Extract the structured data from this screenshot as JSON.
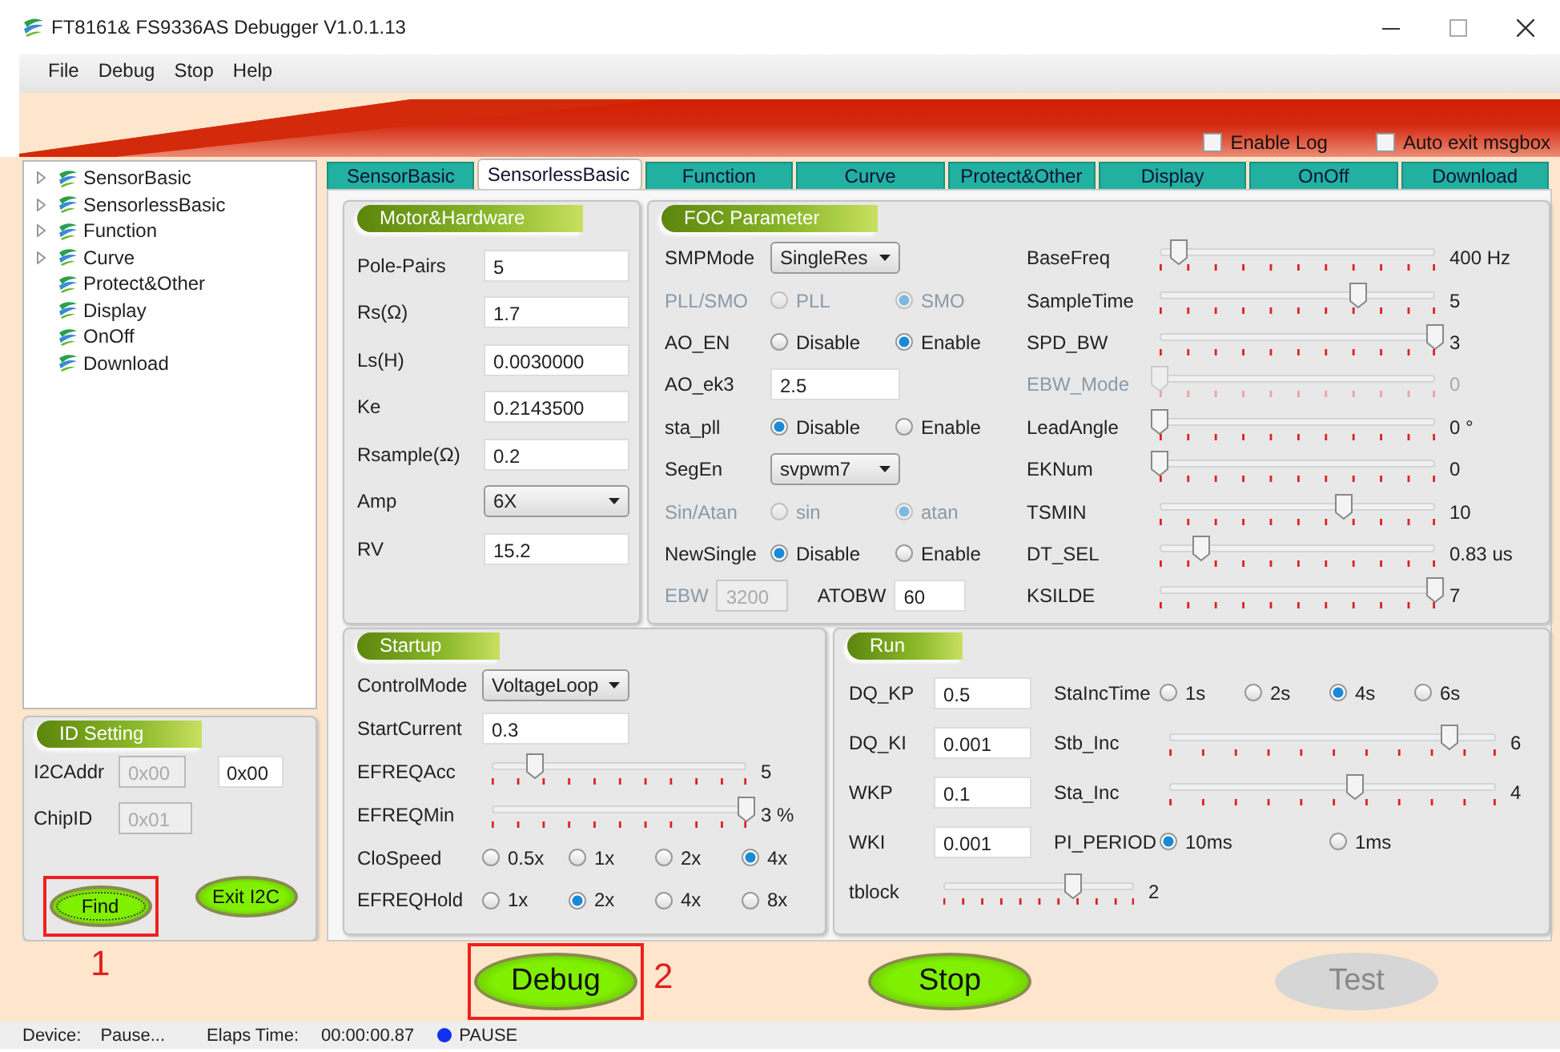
{
  "window": {
    "title": "FT8161& FS9336AS Debugger V1.0.1.13"
  },
  "menu": [
    "File",
    "Debug",
    "Stop",
    "Help"
  ],
  "options": [
    {
      "label": "Enable Log",
      "checked": false
    },
    {
      "label": "Auto exit msgbox",
      "checked": false
    }
  ],
  "tree": [
    {
      "label": "SensorBasic",
      "has_children": true
    },
    {
      "label": "SensorlessBasic",
      "has_children": true
    },
    {
      "label": "Function",
      "has_children": true
    },
    {
      "label": "Curve",
      "has_children": true
    },
    {
      "label": "Protect&Other",
      "has_children": false
    },
    {
      "label": "Display",
      "has_children": false
    },
    {
      "label": "OnOff",
      "has_children": false
    },
    {
      "label": "Download",
      "has_children": false
    }
  ],
  "tabs": [
    {
      "label": "SensorBasic",
      "selected": false
    },
    {
      "label": "SensorlessBasic",
      "selected": true
    },
    {
      "label": "Function",
      "selected": false
    },
    {
      "label": "Curve",
      "selected": false
    },
    {
      "label": "Protect&Other",
      "selected": false
    },
    {
      "label": "Display",
      "selected": false
    },
    {
      "label": "OnOff",
      "selected": false
    },
    {
      "label": "Download",
      "selected": false
    }
  ],
  "panels": [
    {
      "title": "Motor&Hardware",
      "columns": [
        [
          {
            "label": "Pole-Pairs",
            "kind": "input",
            "value": "5",
            "disabled": false
          },
          {
            "label": "Rs(Ω)",
            "kind": "input",
            "value": "1.7",
            "disabled": false
          },
          {
            "label": "Ls(H)",
            "kind": "input",
            "value": "0.0030000",
            "disabled": false
          },
          {
            "label": "Ke",
            "kind": "input",
            "value": "0.2143500",
            "disabled": false
          },
          {
            "label": "Rsample(Ω)",
            "kind": "input",
            "value": "0.2",
            "disabled": false
          },
          {
            "label": "Amp",
            "kind": "select",
            "value": "6X",
            "disabled": false
          },
          {
            "label": "RV",
            "kind": "input",
            "value": "15.2",
            "disabled": false
          }
        ]
      ]
    },
    {
      "title": "FOC Parameter",
      "columns": [
        [
          {
            "label": "SMPMode",
            "kind": "select",
            "value": "SingleRes",
            "disabled": false
          },
          {
            "label": "PLL/SMO",
            "kind": "radio",
            "disabled": true,
            "options": [
              {
                "label": "PLL",
                "selected": false
              },
              {
                "label": "SMO",
                "selected": true
              }
            ]
          },
          {
            "label": "AO_EN",
            "kind": "radio",
            "disabled": false,
            "options": [
              {
                "label": "Disable",
                "selected": false
              },
              {
                "label": "Enable",
                "selected": true
              }
            ]
          },
          {
            "label": "AO_ek3",
            "kind": "input",
            "value": "2.5",
            "disabled": false
          },
          {
            "label": "sta_pll",
            "kind": "radio",
            "disabled": false,
            "options": [
              {
                "label": "Disable",
                "selected": true
              },
              {
                "label": "Enable",
                "selected": false
              }
            ]
          },
          {
            "label": "SegEn",
            "kind": "select",
            "value": "svpwm7",
            "disabled": false
          },
          {
            "label": "Sin/Atan",
            "kind": "radio",
            "disabled": true,
            "options": [
              {
                "label": "sin",
                "selected": false
              },
              {
                "label": "atan",
                "selected": true
              }
            ]
          },
          {
            "label": "NewSingle",
            "kind": "radio",
            "disabled": false,
            "options": [
              {
                "label": "Disable",
                "selected": true
              },
              {
                "label": "Enable",
                "selected": false
              }
            ]
          },
          {
            "kind": "inputs",
            "fields": [
              {
                "label": "EBW",
                "value": "3200",
                "disabled": true
              },
              {
                "label": "ATOBW",
                "value": "60",
                "disabled": false
              }
            ]
          }
        ],
        [
          {
            "label": "BaseFreq",
            "kind": "slider",
            "level": 0.07,
            "reading": "400 Hz",
            "disabled": false
          },
          {
            "label": "SampleTime",
            "kind": "slider",
            "level": 0.72,
            "reading": "5",
            "disabled": false
          },
          {
            "label": "SPD_BW",
            "kind": "slider",
            "level": 1,
            "reading": "3",
            "disabled": false
          },
          {
            "label": "EBW_Mode",
            "kind": "slider",
            "level": 0,
            "reading": "0",
            "disabled": true
          },
          {
            "label": "LeadAngle",
            "kind": "slider",
            "level": 0,
            "reading": "0 °",
            "disabled": false
          },
          {
            "label": "EKNum",
            "kind": "slider",
            "level": 0,
            "reading": "0",
            "disabled": false
          },
          {
            "label": "TSMIN",
            "kind": "slider",
            "level": 0.67,
            "reading": "10",
            "disabled": false
          },
          {
            "label": "DT_SEL",
            "kind": "slider",
            "level": 0.15,
            "reading": "0.83 us",
            "disabled": false
          },
          {
            "label": "KSILDE",
            "kind": "slider",
            "level": 1,
            "reading": "7",
            "disabled": false
          }
        ]
      ]
    },
    {
      "title": "Startup",
      "columns": [
        [
          {
            "label": "ControlMode",
            "kind": "select",
            "value": "VoltageLoop",
            "disabled": false
          },
          {
            "label": "StartCurrent",
            "kind": "input",
            "value": "0.3",
            "disabled": false
          },
          {
            "label": "EFREQAcc",
            "kind": "slider",
            "level": 0.17,
            "reading": "5",
            "disabled": false
          },
          {
            "label": "EFREQMin",
            "kind": "slider",
            "level": 1,
            "reading": "3 %",
            "disabled": false
          },
          {
            "label": "CloSpeed",
            "kind": "radio",
            "disabled": false,
            "options": [
              {
                "label": "0.5x",
                "selected": false
              },
              {
                "label": "1x",
                "selected": false
              },
              {
                "label": "2x",
                "selected": false
              },
              {
                "label": "4x",
                "selected": true
              }
            ]
          },
          {
            "label": "EFREQHold",
            "kind": "radio",
            "disabled": false,
            "options": [
              {
                "label": "1x",
                "selected": false
              },
              {
                "label": "2x",
                "selected": true
              },
              {
                "label": "4x",
                "selected": false
              },
              {
                "label": "8x",
                "selected": false
              }
            ]
          }
        ]
      ]
    },
    {
      "title": "Run",
      "columns": [
        [
          {
            "label": "DQ_KP",
            "kind": "input",
            "value": "0.5",
            "disabled": false
          },
          {
            "label": "DQ_KI",
            "kind": "input",
            "value": "0.001",
            "disabled": false
          },
          {
            "label": "WKP",
            "kind": "input",
            "value": "0.1",
            "disabled": false
          },
          {
            "label": "WKI",
            "kind": "input",
            "value": "0.001",
            "disabled": false
          }
        ],
        [
          {
            "label": "StaIncTime",
            "kind": "radio",
            "disabled": false,
            "options": [
              {
                "label": "1s",
                "selected": false
              },
              {
                "label": "2s",
                "selected": false
              },
              {
                "label": "4s",
                "selected": true
              },
              {
                "label": "6s",
                "selected": false
              }
            ]
          },
          {
            "label": "Stb_Inc",
            "kind": "slider",
            "level": 0.86,
            "reading": "6",
            "disabled": false
          },
          {
            "label": "Sta_Inc",
            "kind": "slider",
            "level": 0.57,
            "reading": "4",
            "disabled": false
          },
          {
            "label": "PI_PERIOD",
            "kind": "radio",
            "disabled": false,
            "options": [
              {
                "label": "10ms",
                "selected": true
              },
              {
                "label": "1ms",
                "selected": false
              }
            ]
          }
        ]
      ],
      "footer": [
        {
          "label": "tblock",
          "kind": "slider",
          "level": 0.68,
          "reading": "2",
          "disabled": false
        }
      ]
    }
  ],
  "id_setting": {
    "title": "ID Setting",
    "rows": [
      {
        "label": "I2CAddr",
        "fields": [
          {
            "value": "0x00",
            "disabled": true
          },
          {
            "value": "0x00",
            "disabled": false
          }
        ]
      },
      {
        "label": "ChipID",
        "fields": [
          {
            "value": "0x01",
            "disabled": true
          }
        ]
      }
    ],
    "buttons": [
      {
        "label": "Find",
        "disabled": false,
        "focused": true,
        "highlighted": true,
        "callout": "1"
      },
      {
        "label": "Exit I2C",
        "disabled": false,
        "focused": false,
        "highlighted": false
      }
    ]
  },
  "actions": [
    {
      "label": "Debug",
      "disabled": false,
      "focused": false,
      "highlighted": true,
      "callout": "2"
    },
    {
      "label": "Stop",
      "disabled": false,
      "focused": false,
      "highlighted": false
    },
    {
      "label": "Test",
      "disabled": true,
      "focused": false,
      "highlighted": false
    }
  ],
  "status_bar": {
    "device_label": "Device:",
    "device": "Pause...",
    "time_label": "Elaps Time:",
    "time": "00:00:00.87",
    "state": "PAUSE"
  }
}
